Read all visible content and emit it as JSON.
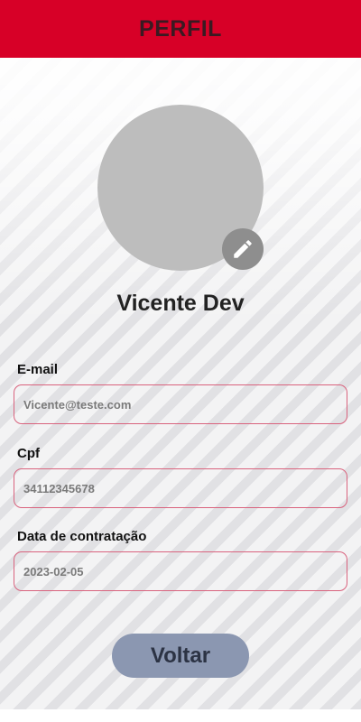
{
  "header": {
    "title": "PERFIL"
  },
  "profile": {
    "name": "Vicente Dev",
    "edit_icon": "pencil-icon"
  },
  "fields": {
    "email": {
      "label": "E-mail",
      "value": "Vicente@teste.com"
    },
    "cpf": {
      "label": "Cpf",
      "value": "34112345678"
    },
    "hire_date": {
      "label": "Data de contratação",
      "value": "2023-02-05"
    }
  },
  "actions": {
    "back_label": "Voltar"
  },
  "colors": {
    "header_bg": "#d70027",
    "input_border": "#d9637e",
    "button_bg": "#8b97b1",
    "avatar_bg": "#bdbdbd"
  }
}
